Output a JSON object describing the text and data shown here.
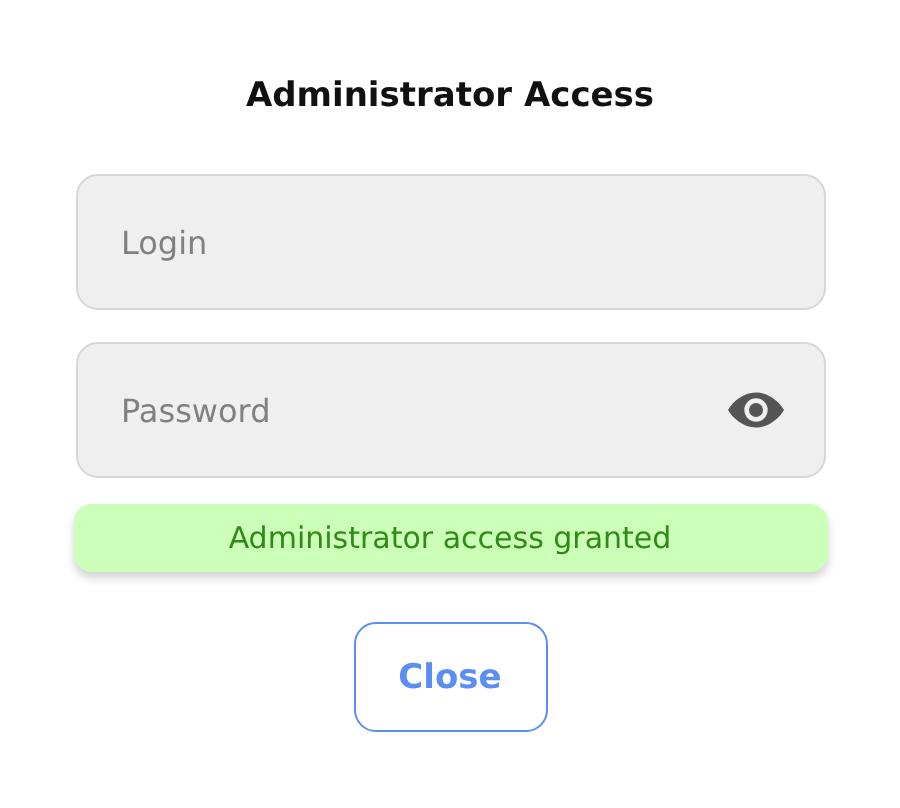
{
  "title": "Administrator Access",
  "fields": [
    {
      "kind": "text",
      "placeholder": "Login"
    },
    {
      "kind": "password",
      "placeholder": "Password"
    }
  ],
  "status": {
    "kind": "success",
    "text": "Administrator access granted"
  },
  "buttons": [
    "Close"
  ]
}
